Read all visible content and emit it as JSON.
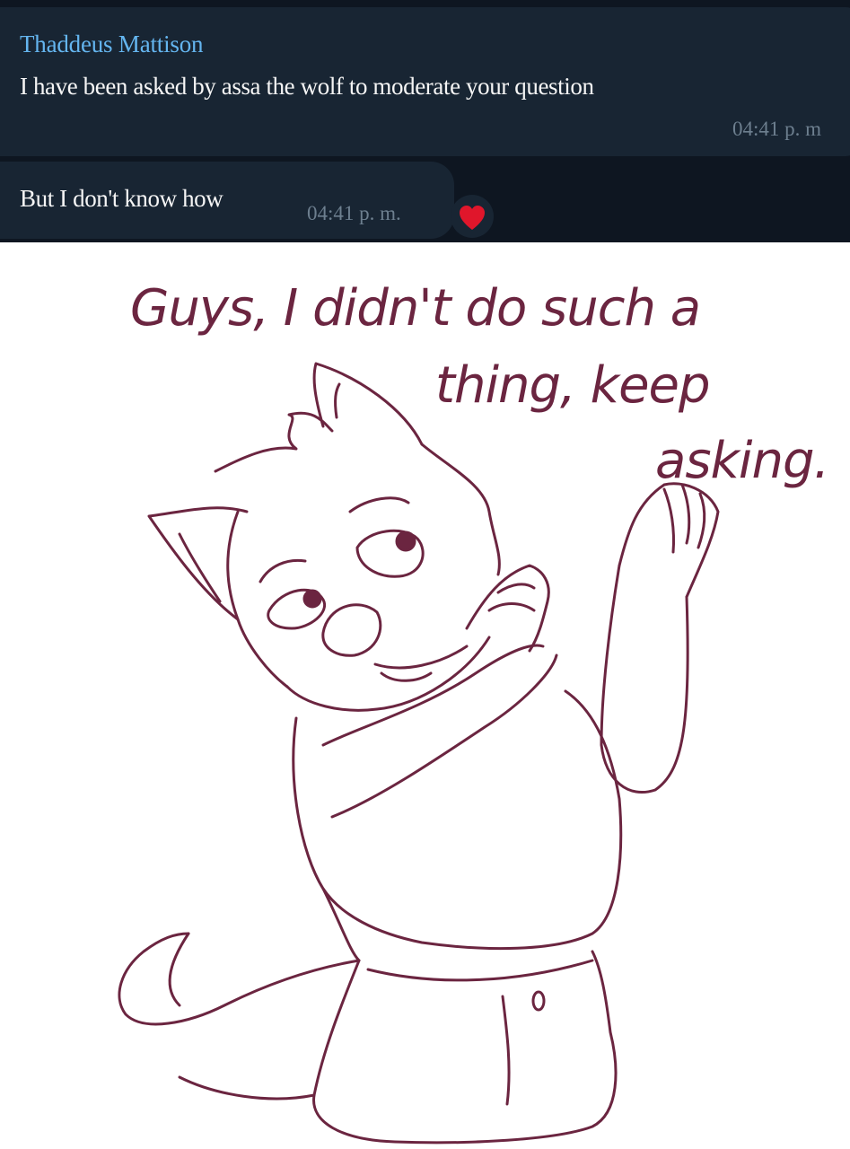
{
  "chat": {
    "messages": [
      {
        "sender": "Thaddeus Mattison",
        "text": "I have been asked by assa the wolf to moderate your question",
        "time": "04:41 p. m"
      },
      {
        "sender": "",
        "text": "But I don't know how",
        "time": "04:41 p. m.",
        "reaction": "heart-icon"
      }
    ]
  },
  "drawing": {
    "caption_lines": [
      "Guys, I didn't do such a",
      "thing, keep",
      "asking."
    ]
  },
  "colors": {
    "chat_background": "#0e1621",
    "bubble": "#182533",
    "sender_name": "#64b5ef",
    "timestamp": "#6d7f8f",
    "reaction_heart": "#e0162b",
    "ink": "#6b2540"
  }
}
